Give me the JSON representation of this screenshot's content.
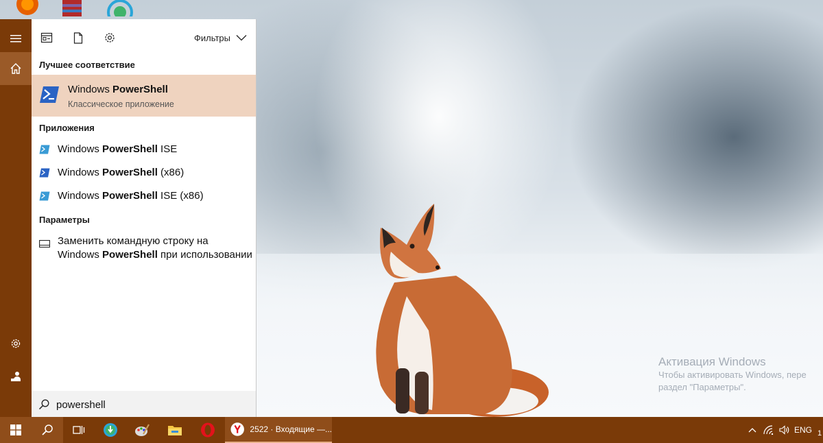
{
  "search_panel": {
    "filters_label": "Фильтры",
    "best_match_header": "Лучшее соответствие",
    "best_match": {
      "title_prefix": "Windows ",
      "title_bold": "PowerShell",
      "subtitle": "Классическое приложение"
    },
    "apps_header": "Приложения",
    "apps": [
      {
        "prefix": "Windows ",
        "bold": "PowerShell",
        "suffix": " ISE"
      },
      {
        "prefix": "Windows ",
        "bold": "PowerShell",
        "suffix": " (x86)"
      },
      {
        "prefix": "Windows ",
        "bold": "PowerShell",
        "suffix": " ISE (x86)"
      }
    ],
    "settings_header": "Параметры",
    "setting": {
      "line1": "Заменить командную строку на",
      "line2_prefix": "Windows ",
      "line2_bold": "PowerShell",
      "line2_suffix": " при использовании"
    },
    "search_query": "powershell"
  },
  "taskbar": {
    "mail_task_title": "2522 · Входящие —...",
    "language": "ENG",
    "clock_partial": "1"
  },
  "desktop": {
    "activation_title": "Активация Windows",
    "activation_line1": "Чтобы активировать Windows, пере",
    "activation_line2": "раздел \"Параметры\"."
  },
  "icons": {
    "rail": [
      "hamburger-icon",
      "home-icon",
      "settings-gear-icon",
      "user-account-icon"
    ],
    "toolbar": [
      "apps-filter-icon",
      "documents-filter-icon",
      "settings-filter-icon",
      "chevron-down-icon"
    ],
    "taskbar": [
      "windows-start-icon",
      "search-icon",
      "task-view-icon",
      "green-app-icon",
      "paint-icon",
      "file-explorer-icon",
      "opera-icon",
      "yandex-browser-icon"
    ],
    "tray": [
      "chevron-up-icon",
      "network-icon",
      "volume-icon"
    ]
  },
  "colors": {
    "accent": "#7a3a08",
    "rail_active": "#9a5a28",
    "selected_result": "#efd3bf",
    "powershell_blue": "#2a63c4"
  }
}
